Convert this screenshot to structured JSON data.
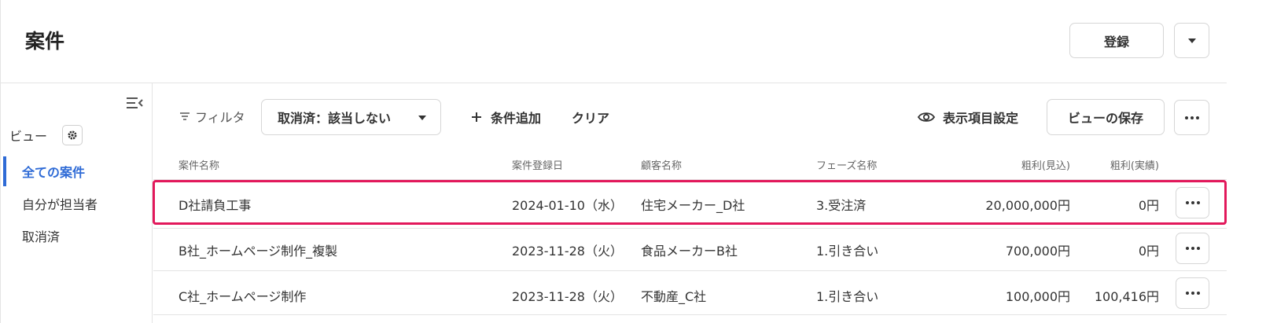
{
  "header": {
    "title": "案件",
    "register_label": "登録"
  },
  "sidebar": {
    "view_label": "ビュー",
    "items": [
      {
        "label": "全ての案件",
        "active": true
      },
      {
        "label": "自分が担当者",
        "active": false
      },
      {
        "label": "取消済",
        "active": false
      }
    ]
  },
  "toolbar": {
    "filter_label": "フィルタ",
    "filter_chip": "取消済：該当しない",
    "add_condition": "条件追加",
    "clear": "クリア",
    "display_settings": "表示項目設定",
    "save_view": "ビューの保存"
  },
  "table": {
    "columns": [
      "案件名称",
      "案件登録日",
      "顧客名称",
      "フェーズ名称",
      "粗利(見込)",
      "粗利(実績)"
    ],
    "rows": [
      {
        "name": "D社請負工事",
        "date": "2024-01-10（水）",
        "customer": "住宅メーカー_D社",
        "phase": "3.受注済",
        "gross_est": "20,000,000円",
        "gross_act": "0円",
        "highlighted": true
      },
      {
        "name": "B社_ホームページ制作_複製",
        "date": "2023-11-28（火）",
        "customer": "食品メーカーB社",
        "phase": "1.引き合い",
        "gross_est": "700,000円",
        "gross_act": "0円",
        "highlighted": false
      },
      {
        "name": "C社_ホームページ制作",
        "date": "2023-11-28（火）",
        "customer": "不動産_C社",
        "phase": "1.引き合い",
        "gross_est": "100,000円",
        "gross_act": "100,416円",
        "highlighted": false
      }
    ]
  },
  "colors": {
    "accent": "#2f6bd6",
    "highlight": "#e2185b"
  }
}
